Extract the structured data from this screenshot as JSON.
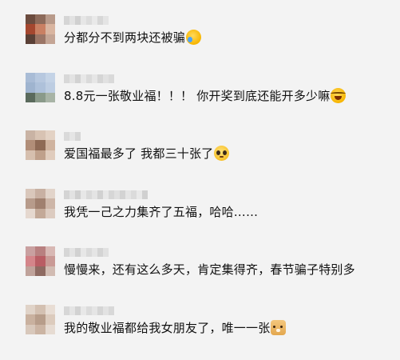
{
  "comments": [
    {
      "text": "分都分不到两块还被骗",
      "emoji": "crying-face-emoji"
    },
    {
      "text": "8.8元一张敬业福！！！ 你开奖到底还能开多少嘛",
      "emoji": "tears-of-joy-emoji"
    },
    {
      "text": "爱国福最多了 我都三十张了",
      "emoji": "pleading-face-emoji"
    },
    {
      "text": "我凭一己之力集齐了五福，哈哈……",
      "emoji": ""
    },
    {
      "text": "慢慢来，还有这么多天，肯定集得齐，春节骗子特别多",
      "emoji": ""
    },
    {
      "text": "我的敬业福都给我女朋友了，唯一一张",
      "emoji": "doge-emoji"
    }
  ],
  "colors": {
    "background": "#f3f3f3",
    "text": "#111111"
  }
}
